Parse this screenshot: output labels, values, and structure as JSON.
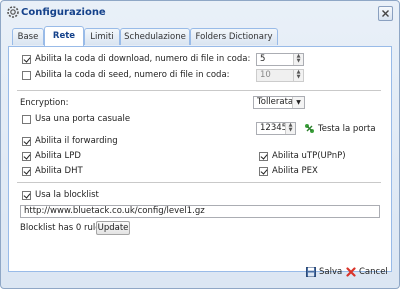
{
  "dialog": {
    "title": "Configurazione"
  },
  "tabs": [
    {
      "label": "Base",
      "active": false
    },
    {
      "label": "Rete",
      "active": true
    },
    {
      "label": "Limiti",
      "active": false
    },
    {
      "label": "Schedulazione",
      "active": false
    },
    {
      "label": "Folders Dictionary",
      "active": false
    }
  ],
  "queue": {
    "download_label": "Abilita la coda di download, numero di file in coda:",
    "download_checked": true,
    "download_value": "5",
    "seed_label": "Abilita la coda di seed, numero di file in coda:",
    "seed_checked": false,
    "seed_value": "10"
  },
  "encryption": {
    "label": "Encryption:",
    "selected": "Tollerata"
  },
  "port": {
    "random_label": "Usa una porta casuale",
    "random_checked": false,
    "value": "12345",
    "test_label": "Testa la porta"
  },
  "options": {
    "forwarding_label": "Abilita il forwarding",
    "lpd_label": "Abilita LPD",
    "upnp_label": "Abilita uTP(UPnP)",
    "dht_label": "Abilita DHT",
    "pex_label": "Abilita PEX"
  },
  "blocklist": {
    "use_label": "Usa la blocklist",
    "url": "http://www.bluetack.co.uk/config/level1.gz",
    "status": "Blocklist has 0 rules.",
    "update_label": "Update"
  },
  "footer": {
    "save_label": "Salva",
    "cancel_label": "Cancel"
  },
  "colors": {
    "title": "#15428b",
    "tab_border": "#99bbe8",
    "test_icon": "#3aa03a",
    "cancel_icon": "#d9342b"
  }
}
